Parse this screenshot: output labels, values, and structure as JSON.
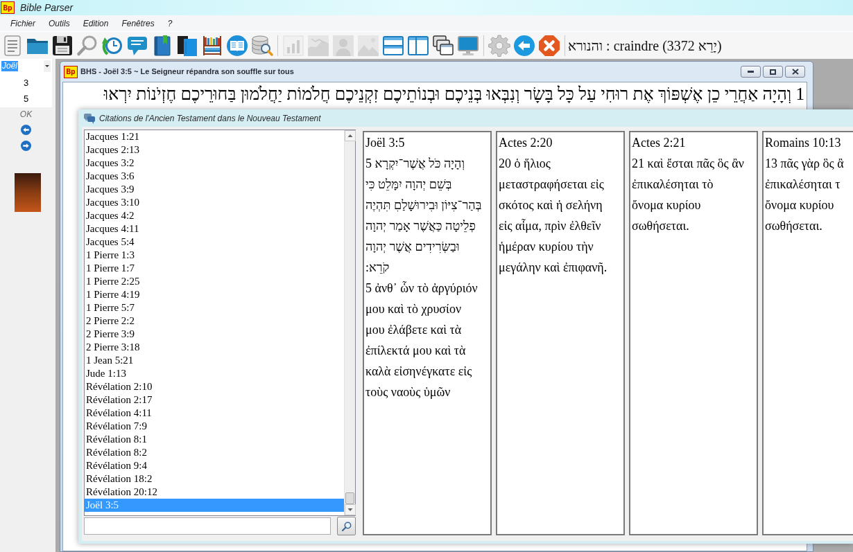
{
  "app_window": {
    "logo": "Bp",
    "title": "Bible Parser"
  },
  "menu": [
    "Fichier",
    "Outils",
    "Edition",
    "Fenêtres",
    "?"
  ],
  "toolbar": {
    "groups": [
      {
        "buttons": [
          {
            "kind": "document",
            "disabled": false
          },
          {
            "kind": "folder",
            "disabled": false
          },
          {
            "kind": "save",
            "disabled": false
          },
          {
            "kind": "search",
            "disabled": false
          },
          {
            "kind": "history",
            "disabled": false
          },
          {
            "kind": "comment",
            "disabled": false
          },
          {
            "kind": "bookmark",
            "disabled": false
          },
          {
            "kind": "books",
            "disabled": false
          },
          {
            "kind": "library",
            "disabled": false
          },
          {
            "kind": "reader",
            "disabled": false
          },
          {
            "kind": "database",
            "disabled": false
          }
        ]
      },
      {
        "buttons": [
          {
            "kind": "chart",
            "disabled": true
          },
          {
            "kind": "map",
            "disabled": true
          },
          {
            "kind": "portrait",
            "disabled": true
          },
          {
            "kind": "picture",
            "disabled": true
          },
          {
            "kind": "rows",
            "disabled": false
          },
          {
            "kind": "columns",
            "disabled": false
          },
          {
            "kind": "cascade",
            "disabled": false
          },
          {
            "kind": "monitor",
            "disabled": false
          }
        ]
      },
      {
        "buttons": [
          {
            "kind": "settings",
            "disabled": false
          },
          {
            "kind": "back",
            "disabled": false
          },
          {
            "kind": "cancel",
            "disabled": false
          }
        ]
      }
    ],
    "lookup": "והנורא : craindre (3372 יָרֵא)"
  },
  "sidebar": {
    "book": {
      "value": "Joël",
      "highlighted": true
    },
    "chapter": "3",
    "verse": "5",
    "ok": "OK"
  },
  "bhs_window": {
    "logo": "Bp",
    "title": "BHS - Joël 3:5 ~ Le Seigneur répandra son souffle sur tous",
    "verse": "1 וְהָיָה אַחֲרֵי כֵן אֶשְׁפּוֹךְ אֶת רוּחִי עַל כָּל בָּשָׂר וְנִבְּאוּ בְּנֵיכֶם וּבְנוֹתֵיכֶם זִקְנֵיכֶם חֲלֹמוֹת יַחֲלֹמוּן בַּחוּרֵיכֶם חֶזְיֹנוֹת יִרְאוּ"
  },
  "citations_dialog": {
    "title": "Citations de l'Ancien Testament dans le Nouveau Testament",
    "references": [
      {
        "label": "Jacques 1:21",
        "selected": false
      },
      {
        "label": "Jacques 2:13",
        "selected": false
      },
      {
        "label": "Jacques 3:2",
        "selected": false
      },
      {
        "label": "Jacques 3:6",
        "selected": false
      },
      {
        "label": "Jacques 3:9",
        "selected": false
      },
      {
        "label": "Jacques 3:10",
        "selected": false
      },
      {
        "label": "Jacques 4:2",
        "selected": false
      },
      {
        "label": "Jacques 4:11",
        "selected": false
      },
      {
        "label": "Jacques 5:4",
        "selected": false
      },
      {
        "label": "1 Pierre 1:3",
        "selected": false
      },
      {
        "label": "1 Pierre 1:7",
        "selected": false
      },
      {
        "label": "1 Pierre 2:25",
        "selected": false
      },
      {
        "label": "1 Pierre 4:19",
        "selected": false
      },
      {
        "label": "1 Pierre 5:7",
        "selected": false
      },
      {
        "label": "2 Pierre 2:2",
        "selected": false
      },
      {
        "label": "2 Pierre 3:9",
        "selected": false
      },
      {
        "label": "2 Pierre 3:18",
        "selected": false
      },
      {
        "label": "1 Jean 5:21",
        "selected": false
      },
      {
        "label": "Jude 1:13",
        "selected": false
      },
      {
        "label": "Révélation 2:10",
        "selected": false
      },
      {
        "label": "Révélation 2:17",
        "selected": false
      },
      {
        "label": "Révélation 4:11",
        "selected": false
      },
      {
        "label": "Révélation 7:9",
        "selected": false
      },
      {
        "label": "Révélation 8:1",
        "selected": false
      },
      {
        "label": "Révélation 8:2",
        "selected": false
      },
      {
        "label": "Révélation 9:4",
        "selected": false
      },
      {
        "label": "Révélation 18:2",
        "selected": false
      },
      {
        "label": "Révélation 20:12",
        "selected": false
      },
      {
        "label": "Joël 3:5",
        "selected": true
      }
    ],
    "columns": [
      {
        "title": "Joël 3:5",
        "passages": [
          {
            "lines": [
              "5  וְהָיָה כֹּל אֲשֶׁר־יִקְרָא",
              "בְּשֵׁם יְהוָה יִמָּלֵט כִּי",
              "בְּהַר־צִיּוֹן וּבִירוּשָׁלַםִ תִּהְיֶה",
              "פְלֵיטָה כַּאֲשֶׁר אָמַר יְהוָה",
              "וּבַשְּׂרִידִים אֲשֶׁר יְהוָה",
              ":קֹרֵא"
            ]
          },
          {
            "lines": [
              "5 ἀνθ᾽ ὧν τὸ ἀργύριόν",
              "μου καὶ τὸ χρυσίον",
              "μου ἐλάβετε καὶ τὰ",
              "ἐπίλεκτά μου καὶ τὰ",
              "καλὰ εἰσηνέγκατε εἰς",
              "τοὺς ναοὺς ὑμῶν"
            ]
          }
        ]
      },
      {
        "title": "Actes 2:20",
        "passages": [
          {
            "lines": [
              "20 ὁ ἥλιος",
              "μεταστραφήσεται εἰς",
              "σκότος καὶ ἡ σελήνη",
              "εἰς αἷμα, πρὶν ἐλθεῖν",
              "ἡμέραν κυρίου τὴν",
              "μεγάλην καὶ ἐπιφανῆ."
            ]
          }
        ]
      },
      {
        "title": "Actes 2:21",
        "passages": [
          {
            "lines": [
              "21 καὶ ἔσται πᾶς ὃς ἂν",
              "ἐπικαλέσηται τὸ",
              "ὄνομα κυρίου",
              "σωθήσεται."
            ]
          }
        ]
      },
      {
        "title": "Romains 10:13",
        "passages": [
          {
            "lines": [
              "13 πᾶς γὰρ ὃς ἂ",
              "ἐπικαλέσηται τ",
              "ὄνομα κυρίου",
              "σωθήσεται."
            ]
          }
        ]
      }
    ]
  }
}
